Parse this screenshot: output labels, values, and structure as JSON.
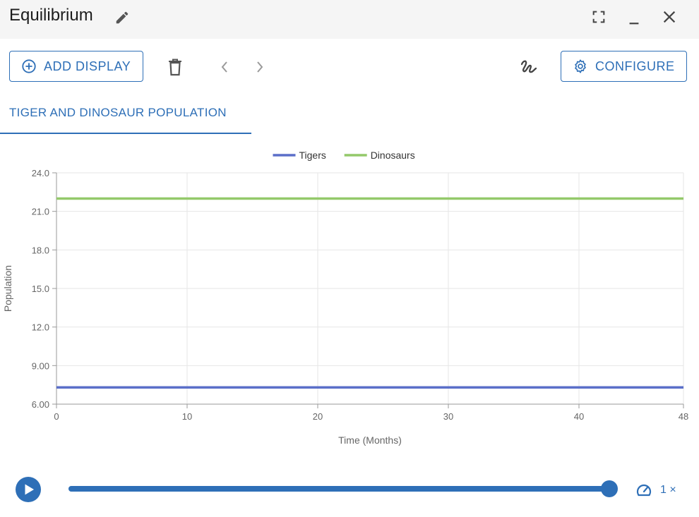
{
  "window": {
    "title": "Equilibrium"
  },
  "toolbar": {
    "add_display_label": "ADD DISPLAY",
    "configure_label": "CONFIGURE"
  },
  "tabs": [
    {
      "label": "TIGER AND DINOSAUR POPULATION",
      "selected": true
    }
  ],
  "chart_data": {
    "type": "line",
    "title": "",
    "xlabel": "Time (Months)",
    "ylabel": "Population",
    "xlim": [
      0,
      48
    ],
    "ylim": [
      6,
      24
    ],
    "x_ticks": [
      "0",
      "10",
      "20",
      "30",
      "40",
      "48"
    ],
    "x_tick_values": [
      0,
      10,
      20,
      30,
      40,
      48
    ],
    "y_ticks": [
      "24.0",
      "21.0",
      "18.0",
      "15.0",
      "12.0",
      "9.00",
      "6.00"
    ],
    "y_tick_values": [
      24,
      21,
      18,
      15,
      12,
      9,
      6
    ],
    "grid": true,
    "legend_position": "top-center",
    "x": [
      0,
      10,
      20,
      30,
      40,
      48
    ],
    "series": [
      {
        "name": "Tigers",
        "color": "#5b6fc9",
        "values": [
          7.3,
          7.3,
          7.3,
          7.3,
          7.3,
          7.3
        ]
      },
      {
        "name": "Dinosaurs",
        "color": "#94c96a",
        "values": [
          22,
          22,
          22,
          22,
          22,
          22
        ]
      }
    ]
  },
  "playback": {
    "progress": 1.0,
    "speed_label": "1 ×",
    "accent": "#2e6fb7"
  },
  "icons": {
    "edit": "pencil-icon",
    "fullscreen": "fullscreen-icon",
    "minimize": "minimize-icon",
    "close": "close-icon",
    "add": "plus-circle-icon",
    "delete": "trash-icon",
    "prev": "chevron-left-icon",
    "next": "chevron-right-icon",
    "draw": "squiggle-icon",
    "settings": "gear-icon",
    "play": "play-icon",
    "speed": "speedometer-icon"
  }
}
